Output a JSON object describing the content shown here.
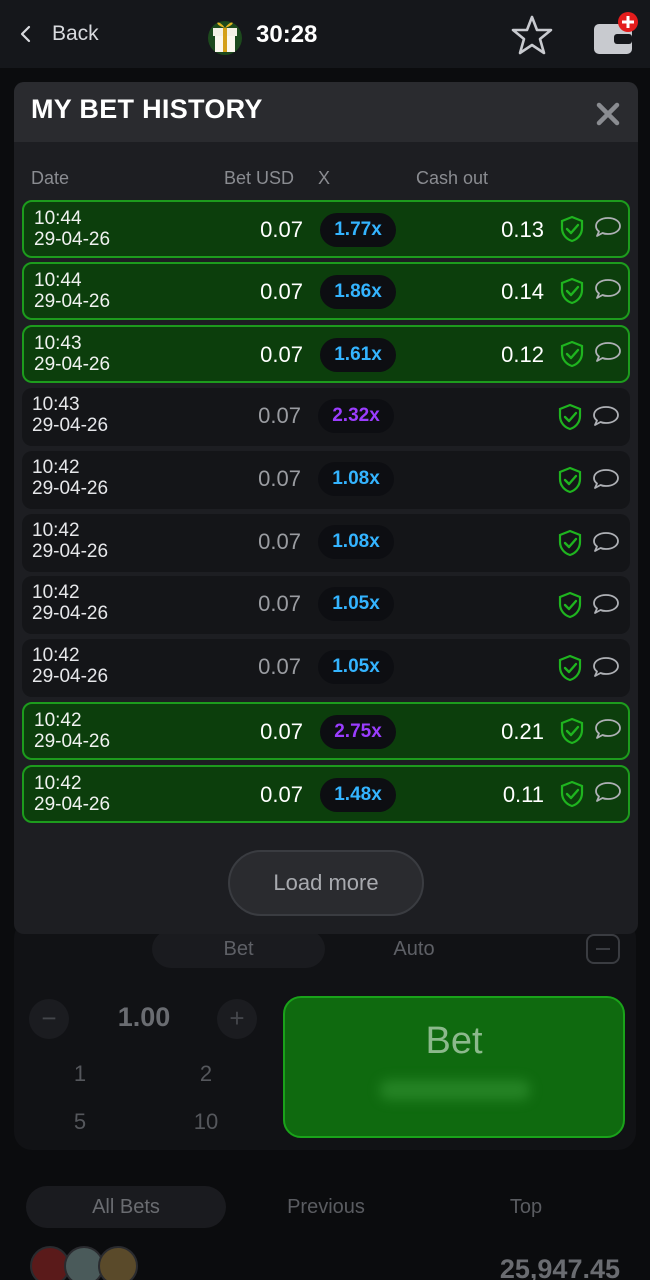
{
  "topbar": {
    "back_label": "Back",
    "timer": "30:28",
    "accent_red": "#e31c1c"
  },
  "modal": {
    "title": "MY BET HISTORY",
    "columns": {
      "date": "Date",
      "bet": "Bet USD",
      "x": "X",
      "cashout": "Cash out"
    },
    "rows": [
      {
        "time": "10:44",
        "date": "29-04-26",
        "bet": "0.07",
        "mult": "1.77x",
        "cashout": "0.13",
        "won": true,
        "mult_color": "#34b4ff"
      },
      {
        "time": "10:44",
        "date": "29-04-26",
        "bet": "0.07",
        "mult": "1.86x",
        "cashout": "0.14",
        "won": true,
        "mult_color": "#34b4ff"
      },
      {
        "time": "10:43",
        "date": "29-04-26",
        "bet": "0.07",
        "mult": "1.61x",
        "cashout": "0.12",
        "won": true,
        "mult_color": "#34b4ff"
      },
      {
        "time": "10:43",
        "date": "29-04-26",
        "bet": "0.07",
        "mult": "2.32x",
        "cashout": "",
        "won": false,
        "mult_color": "#9b3dff"
      },
      {
        "time": "10:42",
        "date": "29-04-26",
        "bet": "0.07",
        "mult": "1.08x",
        "cashout": "",
        "won": false,
        "mult_color": "#34b4ff"
      },
      {
        "time": "10:42",
        "date": "29-04-26",
        "bet": "0.07",
        "mult": "1.08x",
        "cashout": "",
        "won": false,
        "mult_color": "#34b4ff"
      },
      {
        "time": "10:42",
        "date": "29-04-26",
        "bet": "0.07",
        "mult": "1.05x",
        "cashout": "",
        "won": false,
        "mult_color": "#34b4ff"
      },
      {
        "time": "10:42",
        "date": "29-04-26",
        "bet": "0.07",
        "mult": "1.05x",
        "cashout": "",
        "won": false,
        "mult_color": "#34b4ff"
      },
      {
        "time": "10:42",
        "date": "29-04-26",
        "bet": "0.07",
        "mult": "2.75x",
        "cashout": "0.21",
        "won": true,
        "mult_color": "#9b3dff"
      },
      {
        "time": "10:42",
        "date": "29-04-26",
        "bet": "0.07",
        "mult": "1.48x",
        "cashout": "0.11",
        "won": true,
        "mult_color": "#34b4ff"
      }
    ],
    "load_more": "Load more",
    "win_color": "#1d9c1d",
    "shield_color": "#1fb41f"
  },
  "background": {
    "tabs": [
      "Bet",
      "Auto"
    ],
    "amount": "1.00",
    "quick": [
      "1",
      "2",
      "5",
      "10"
    ],
    "bet_button": "Bet",
    "bottom_tabs": [
      "All Bets",
      "Previous",
      "Top"
    ],
    "total": "25,947.45",
    "bet_button_color": "#0f6a0f"
  }
}
